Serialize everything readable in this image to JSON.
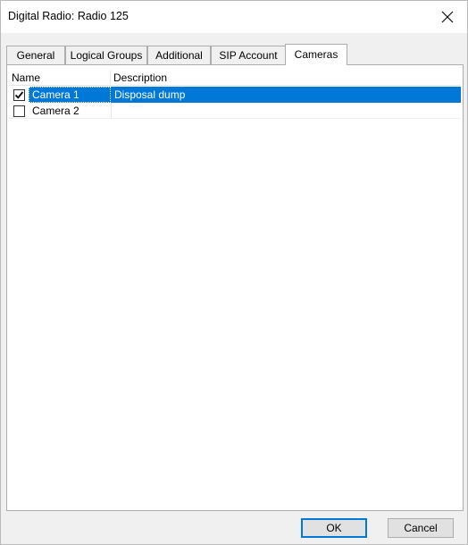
{
  "window": {
    "title": "Digital Radio: Radio 125"
  },
  "tabs": [
    {
      "label": "General"
    },
    {
      "label": "Logical Groups"
    },
    {
      "label": "Additional"
    },
    {
      "label": "SIP Account"
    },
    {
      "label": "Cameras",
      "active": true
    }
  ],
  "list": {
    "columns": [
      "Name",
      "Description"
    ],
    "rows": [
      {
        "checked": true,
        "name": "Camera 1",
        "description": "Disposal dump",
        "selected": true
      },
      {
        "checked": false,
        "name": "Camera 2",
        "description": "",
        "selected": false
      }
    ]
  },
  "buttons": {
    "ok": "OK",
    "cancel": "Cancel"
  },
  "colors": {
    "selection": "#0078d7"
  }
}
